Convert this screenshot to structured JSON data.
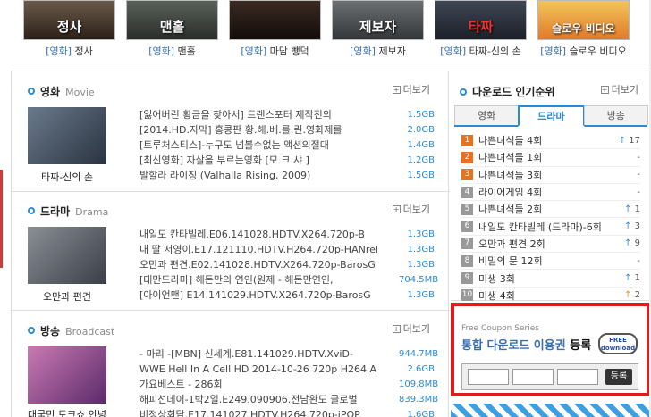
{
  "posters": [
    {
      "cat": "[영화]",
      "title": "정사",
      "art": "정사"
    },
    {
      "cat": "[영화]",
      "title": "맨홀",
      "art": "맨홀"
    },
    {
      "cat": "[영화]",
      "title": "마담 뺑덕",
      "art": ""
    },
    {
      "cat": "[영화]",
      "title": "제보자",
      "art": "제보자"
    },
    {
      "cat": "[영화]",
      "title": "타짜-신의 손",
      "art": "타짜"
    },
    {
      "cat": "[영화]",
      "title": "슬로우 비디오",
      "art": "슬로우 비디오"
    }
  ],
  "sections": [
    {
      "ko": "영화",
      "en": "Movie",
      "more": "더보기",
      "thumb_caption": "타짜-신의 손",
      "items": [
        {
          "t": "[잃어버린 황금을 찾아서] 트랜스포터 제작진의",
          "s": "1.5GB"
        },
        {
          "t": "[2014.HD.자막] 홍콩판 황.해.베.를.린.영화제를",
          "s": "2.0GB"
        },
        {
          "t": "[트루처스티스]-누구도 넘볼수없는 액션의절대",
          "s": "1.4GB"
        },
        {
          "t": "[최신영화] 자살을 부르는영화 [모 크 샤 ]",
          "s": "1.2GB"
        },
        {
          "t": "발할라 라이징 (Valhalla Rising, 2009)",
          "s": "1.5GB"
        }
      ]
    },
    {
      "ko": "드라마",
      "en": "Drama",
      "more": "더보기",
      "thumb_caption": "오만과 편견",
      "items": [
        {
          "t": "내일도 칸타빌레.E06.141028.HDTV.X264.720p-B",
          "s": "1.3GB"
        },
        {
          "t": "내 딸 서영이.E17.121110.HDTV.H264.720p-HANrel",
          "s": "1.3GB"
        },
        {
          "t": "오만과 편견.E02.141028.HDTV.X264.720p-BarosG",
          "s": "1.3GB"
        },
        {
          "t": "[대만드라마] 해돈만의 연인(원제 - 해돈만연인,",
          "s": "704.5MB"
        },
        {
          "t": "[아이언맨] E14.141029.HDTV.X264.720p-BarosG",
          "s": "1.3GB"
        }
      ]
    },
    {
      "ko": "방송",
      "en": "Broadcast",
      "more": "더보기",
      "thumb_caption": "대국민 토크쇼 안녕하",
      "items": [
        {
          "t": "- 마리 -[MBN] 신세계.E81.141029.HDTV.XviD-",
          "s": "944.7MB"
        },
        {
          "t": "WWE Hell In A Cell HD 2014-10-26 720p H264 A",
          "s": "2.6GB"
        },
        {
          "t": "가요베스트 - 286회",
          "s": "109.8MB"
        },
        {
          "t": "해피선데이-1박2일.E249.090906.전남완도 글로벌",
          "s": "839.3MB"
        },
        {
          "t": "비정상회담.E17.141027.HDTV.H264.720p-iPOP",
          "s": "1.6GB"
        }
      ]
    }
  ],
  "ranking": {
    "title": "다운로드 인기순위",
    "more": "더보기",
    "tabs": [
      "영화",
      "드라마",
      "방송"
    ],
    "active_tab": "드라마",
    "rows": [
      {
        "n": "1",
        "t": "나쁜녀석들 4회",
        "c": "17",
        "dir": "up"
      },
      {
        "n": "2",
        "t": "나쁜녀석들 1회",
        "c": "-",
        "dir": ""
      },
      {
        "n": "3",
        "t": "나쁜녀석들 3회",
        "c": "-",
        "dir": ""
      },
      {
        "n": "4",
        "t": "라이어게임 4회",
        "c": "-",
        "dir": ""
      },
      {
        "n": "5",
        "t": "나쁜녀석들 2회",
        "c": "1",
        "dir": "up"
      },
      {
        "n": "6",
        "t": "내일도 칸타빌레 (드라마)-6회",
        "c": "3",
        "dir": "up"
      },
      {
        "n": "7",
        "t": "오만과 편견 2회",
        "c": "9",
        "dir": "up"
      },
      {
        "n": "8",
        "t": "비밀의 문 12회",
        "c": "-",
        "dir": ""
      },
      {
        "n": "9",
        "t": "미생 3회",
        "c": "1",
        "dir": "up"
      },
      {
        "n": "10",
        "t": "미생 4회",
        "c": "2",
        "dir": "up2"
      }
    ]
  },
  "coupon": {
    "series": "Free Coupon Series",
    "title_a": "통합 다운로드 이용권",
    "title_b": "등록",
    "badge_a": "FREE",
    "badge_b": "download",
    "button": "등록"
  }
}
